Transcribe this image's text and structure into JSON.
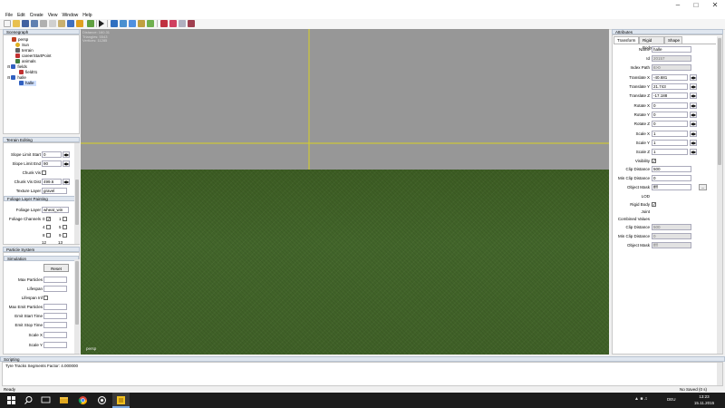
{
  "menu": [
    "File",
    "Edit",
    "Create",
    "View",
    "Window",
    "Help"
  ],
  "scenegraph": {
    "title": "Scenegraph",
    "items": [
      {
        "label": "persp",
        "color": "#c04020"
      },
      {
        "label": "Sun",
        "color": "#e0b020"
      },
      {
        "label": "terrain",
        "color": "#606060"
      },
      {
        "label": "careerStartPoint",
        "color": "#c03030"
      },
      {
        "label": "animals",
        "color": "#408040"
      },
      {
        "label": "fields",
        "color": "#3060c0"
      },
      {
        "label": "field01",
        "color": "#c03030"
      },
      {
        "label": "halle",
        "color": "#3060c0"
      },
      {
        "label": "halle",
        "color": "#3060c0"
      }
    ]
  },
  "terrain_editing": {
    "title": "Terrain Editing",
    "slope_limit_start_label": "Slope Limit Start",
    "slope_limit_start": "0",
    "slope_limit_end_label": "Slope Limit End",
    "slope_limit_end": "90",
    "chunk_vis_label": "Chunk Vis",
    "chunk_vis_dist_label": "Chunk Vis Dist",
    "chunk_vis_dist": "499.6",
    "texture_layer_label": "Texture Layer",
    "texture_layer": "gravel",
    "foliage_painting_title": "Foliage Layer Painting",
    "foliage_layer_label": "Foliage Layer",
    "foliage_layer": "wheat_win",
    "foliage_channels_label": "Foliage Channels",
    "channels": [
      "0",
      "1",
      "4",
      "5",
      "8",
      "9",
      "12",
      "13"
    ]
  },
  "particle_system": {
    "title": "Particle System",
    "simulation_title": "Simulation",
    "reset_label": "Reset",
    "fields": [
      "Max Particles",
      "Lifespan",
      "Lifespan Inf",
      "Max Emit Particles",
      "Emit Start Time",
      "Emit Stop Time",
      "Scale X",
      "Scale Y"
    ]
  },
  "viewport": {
    "stats": [
      "Distance: 160.31",
      "Triangles: 5543",
      "Vertices: 11285"
    ],
    "camera_label": "persp",
    "sky_color": "#979797",
    "guide_color": "#d8d020"
  },
  "attributes": {
    "title": "Attributes",
    "tabs": [
      "Transform",
      "Rigid Body",
      "Shape"
    ],
    "name_label": "Name",
    "name": "halle",
    "id_label": "Id",
    "id": "20157",
    "index_path_label": "Index Path",
    "index_path": "6>0",
    "tx_label": "Translate X",
    "tx": "-40.681",
    "ty_label": "Translate Y",
    "ty": "21.743",
    "tz_label": "Translate Z",
    "tz": "-17.188",
    "rx_label": "Rotate X",
    "rx": "0",
    "ry_label": "Rotate Y",
    "ry": "0",
    "rz_label": "Rotate Z",
    "rz": "0",
    "sx_label": "Scale X",
    "sx": "1",
    "sy_label": "Scale Y",
    "sy": "1",
    "sz_label": "Scale Z",
    "sz": "1",
    "visibility_label": "Visibility",
    "clip_distance_label": "Clip Distance",
    "clip_distance": "500",
    "min_clip_distance_label": "Min Clip Distance",
    "min_clip_distance": "0",
    "object_mask_label": "Object Mask",
    "object_mask": "ffff",
    "browse_label": "...",
    "lod_label": "LOD",
    "rigid_body_label": "Rigid Body",
    "joint_label": "Joint",
    "combined_values_label": "Combined Values",
    "c_clip_distance_label": "Clip Distance",
    "c_clip_distance": "500",
    "c_min_clip_distance_label": "Min Clip Distance",
    "c_min_clip_distance": "0",
    "c_object_mask_label": "Object Mask",
    "c_object_mask": "ffff"
  },
  "scripting": {
    "title": "Scripting",
    "log_line": "Tyre Tracks Segments Factor: 4.000000"
  },
  "status": {
    "left": "Ready",
    "right": "No Saved (0 s)"
  },
  "taskbar": {
    "time": "13:23",
    "date": "15.11.2015",
    "lang": "DEU"
  }
}
